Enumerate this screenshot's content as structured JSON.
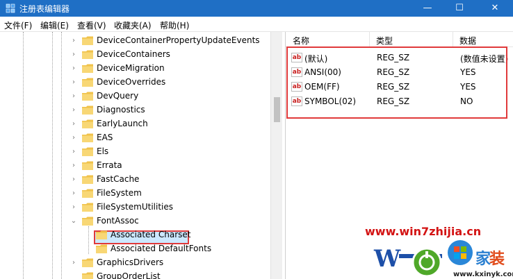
{
  "window": {
    "title": "注册表编辑器",
    "controls": {
      "minimize": "—",
      "maximize": "☐",
      "close": "✕"
    }
  },
  "menu": [
    "文件(F)",
    "编辑(E)",
    "查看(V)",
    "收藏夹(A)",
    "帮助(H)"
  ],
  "tree": {
    "items": [
      {
        "label": "DeviceContainerPropertyUpdateEvents",
        "expander": "›"
      },
      {
        "label": "DeviceContainers",
        "expander": "›"
      },
      {
        "label": "DeviceMigration",
        "expander": "›"
      },
      {
        "label": "DeviceOverrides",
        "expander": "›"
      },
      {
        "label": "DevQuery",
        "expander": "›"
      },
      {
        "label": "Diagnostics",
        "expander": "›"
      },
      {
        "label": "EarlyLaunch",
        "expander": "›"
      },
      {
        "label": "EAS",
        "expander": "›"
      },
      {
        "label": "Els",
        "expander": "›"
      },
      {
        "label": "Errata",
        "expander": "›"
      },
      {
        "label": "FastCache",
        "expander": "›"
      },
      {
        "label": "FileSystem",
        "expander": "›"
      },
      {
        "label": "FileSystemUtilities",
        "expander": "›"
      },
      {
        "label": "FontAssoc",
        "expander": "⌄"
      },
      {
        "label": "Associated Charset",
        "expander": ""
      },
      {
        "label": "Associated DefaultFonts",
        "expander": ""
      },
      {
        "label": "GraphicsDrivers",
        "expander": "›"
      },
      {
        "label": "GroupOrderList",
        "expander": ""
      }
    ]
  },
  "values": {
    "headers": {
      "name": "名称",
      "type": "类型",
      "data": "数据"
    },
    "icon_text": "ab",
    "rows": [
      {
        "name": "(默认)",
        "type": "REG_SZ",
        "data": "(数值未设置)"
      },
      {
        "name": "ANSI(00)",
        "type": "REG_SZ",
        "data": "YES"
      },
      {
        "name": "OEM(FF)",
        "type": "REG_SZ",
        "data": "YES"
      },
      {
        "name": "SYMBOL(02)",
        "type": "REG_SZ",
        "data": "NO"
      }
    ]
  },
  "watermark": {
    "url": "www.win7zhijia.cn",
    "site": "www.kxinyk.com"
  },
  "colors": {
    "titlebar": "#1f6fc5",
    "highlight_border": "#e0393a",
    "selection": "#cce8ff",
    "folder": "#f0c24a"
  }
}
